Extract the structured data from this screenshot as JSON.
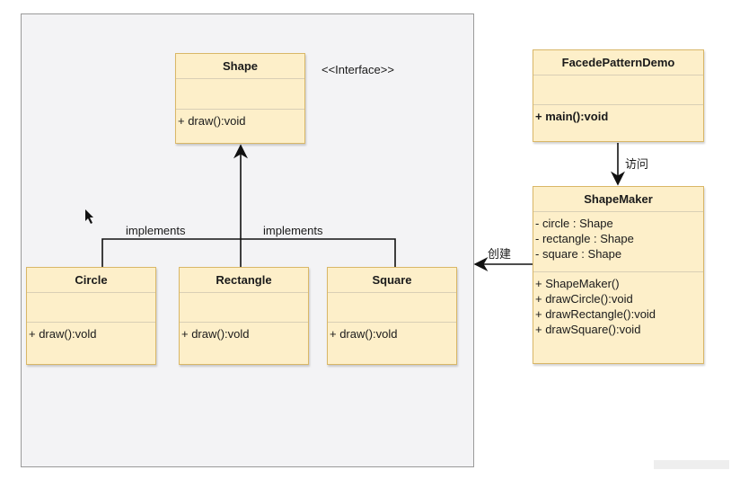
{
  "colors": {
    "class_fill": "#fdefc9",
    "class_border": "#d9b767",
    "canvas": "#f3f3f5"
  },
  "shape": {
    "name": "Shape",
    "stereotype": "<<Interface>>",
    "method": "+ draw():void"
  },
  "circle": {
    "name": "Circle",
    "method": "+ draw():vold"
  },
  "rectangle": {
    "name": "Rectangle",
    "method": "+ draw():vold"
  },
  "square": {
    "name": "Square",
    "method": "+ draw():vold"
  },
  "implements_left": "implements",
  "implements_right": "implements",
  "demo": {
    "name": "FacedePatternDemo",
    "method": "+ main():void"
  },
  "visit_label": "访问",
  "create_label": "创建",
  "maker": {
    "name": "ShapeMaker",
    "attributes": [
      "- circle : Shape",
      "- rectangle : Shape",
      "- square : Shape"
    ],
    "methods": [
      "+ ShapeMaker()",
      "+ drawCircle():void",
      "+ drawRectangle():void",
      "+ drawSquare():void"
    ]
  }
}
